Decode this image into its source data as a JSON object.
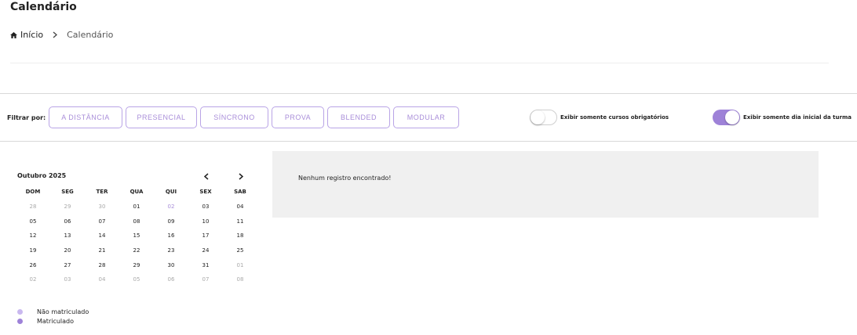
{
  "page": {
    "title": "Calendário"
  },
  "breadcrumb": {
    "home_label": "Início",
    "current": "Calendário"
  },
  "filters": {
    "label": "Filtrar por:",
    "chips": [
      "A DISTÂNCIA",
      "PRESENCIAL",
      "SÍNCRONO",
      "PROVA",
      "BLENDED",
      "MODULAR"
    ]
  },
  "toggles": {
    "mandatory": {
      "label": "Exibir somente cursos obrigatórios",
      "checked": false
    },
    "first_day": {
      "label": "Exibir somente dia inicial da turma",
      "checked": true
    }
  },
  "calendar": {
    "month_label": "Outubro 2025",
    "weekdays": [
      "DOM",
      "SEG",
      "TER",
      "QUA",
      "QUI",
      "SEX",
      "SAB"
    ],
    "weeks": [
      [
        "28",
        "29",
        "30",
        "01",
        "02",
        "03",
        "04"
      ],
      [
        "05",
        "06",
        "07",
        "08",
        "09",
        "10",
        "11"
      ],
      [
        "12",
        "13",
        "14",
        "15",
        "16",
        "17",
        "18"
      ],
      [
        "19",
        "20",
        "21",
        "22",
        "23",
        "24",
        "25"
      ],
      [
        "26",
        "27",
        "28",
        "29",
        "30",
        "31",
        "01"
      ],
      [
        "02",
        "03",
        "04",
        "05",
        "06",
        "07",
        "08"
      ]
    ]
  },
  "legend": [
    {
      "label": "Não matriculado",
      "color": "#c9b8ef"
    },
    {
      "label": "Matriculado",
      "color": "#9e82d8"
    }
  ],
  "results": {
    "empty_message": "Nenhum registro encontrado!"
  },
  "colors": {
    "accent": "#9e82d8",
    "chip_border": "#b9a4e6",
    "chip_text": "#a98ed9"
  }
}
